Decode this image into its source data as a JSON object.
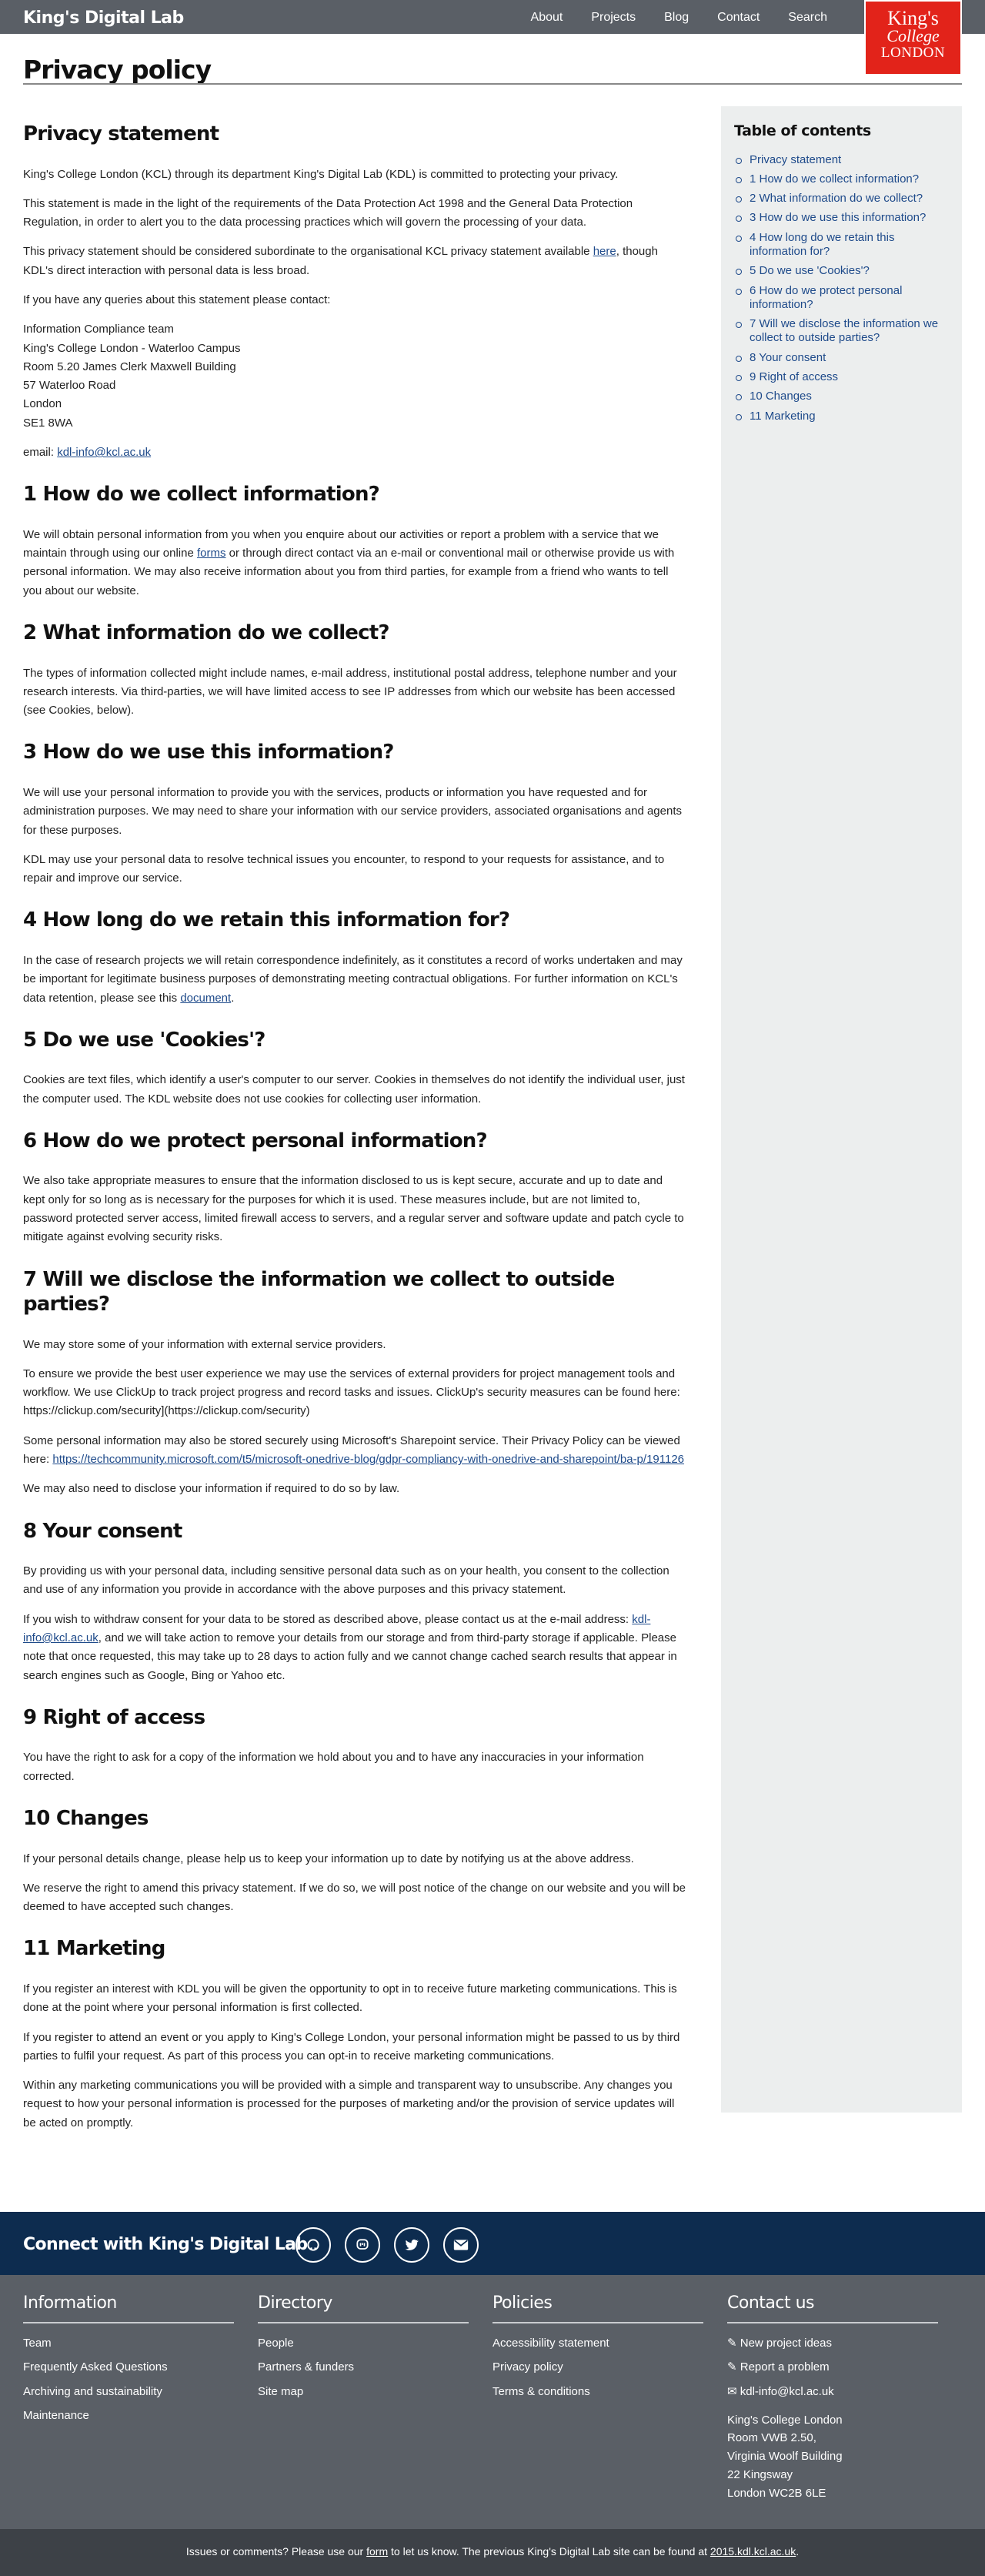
{
  "header": {
    "brand": "King's Digital Lab",
    "nav": [
      "About",
      "Projects",
      "Blog",
      "Contact",
      "Search"
    ],
    "logo": {
      "line1": "King's",
      "line2": "College",
      "line3": "LONDON"
    }
  },
  "page_title": "Privacy policy",
  "content": {
    "intro_heading": "Privacy statement",
    "intro_p1": "King's College London (KCL) through its department King's Digital Lab (KDL) is committed to protecting your privacy.",
    "intro_p2": "This statement is made in the light of the requirements of the Data Protection Act 1998 and the General Data Protection Regulation, in order to alert you to the data processing practices which will govern the processing of your data.",
    "intro_p3_before": "This privacy statement should be considered subordinate to the organisational KCL privacy statement available ",
    "intro_p3_link": "here",
    "intro_p3_after": ", though KDL's direct interaction with personal data is less broad.",
    "intro_p4": "If you have any queries about this statement please contact:",
    "address": [
      "Information Compliance team",
      "King's College London - Waterloo Campus",
      "Room 5.20 James Clerk Maxwell Building",
      "57 Waterloo Road",
      "London",
      "SE1 8WA"
    ],
    "email_label": "email: ",
    "email_link": "kdl-info@kcl.ac.uk",
    "s1_heading": "1 How do we collect information?",
    "s1_p1_before": "We will obtain personal information from you when you enquire about our activities or report a problem with a service that we maintain through using our online ",
    "s1_p1_link": "forms",
    "s1_p1_after": " or through direct contact via an e-mail or conventional mail or otherwise provide us with personal information. We may also receive information about you from third parties, for example from a friend who wants to tell you about our website.",
    "s2_heading": "2 What information do we collect?",
    "s2_p1": "The types of information collected might include names, e-mail address, institutional postal address, telephone number and your research interests. Via third-parties, we will have limited access to see IP addresses from which our website has been accessed (see Cookies, below).",
    "s3_heading": "3 How do we use this information?",
    "s3_p1": "We will use your personal information to provide you with the services, products or information you have requested and for administration purposes. We may need to share your information with our service providers, associated organisations and agents for these purposes.",
    "s3_p2": "KDL may use your personal data to resolve technical issues you encounter, to respond to your requests for assistance, and to repair and improve our service.",
    "s4_heading": "4 How long do we retain this information for?",
    "s4_p1_before": "In the case of research projects we will retain correspondence indefinitely, as it constitutes a record of works undertaken and may be important for legitimate business purposes of demonstrating meeting contractual obligations. For further information on KCL's data retention, please see this ",
    "s4_p1_link": "document",
    "s4_p1_after": ".",
    "s5_heading": "5 Do we use 'Cookies'?",
    "s5_p1": "Cookies are text files, which identify a user's computer to our server. Cookies in themselves do not identify the individual user, just the computer used. The KDL website does not use cookies for collecting user information.",
    "s6_heading": "6 How do we protect personal information?",
    "s6_p1": "We also take appropriate measures to ensure that the information disclosed to us is kept secure, accurate and up to date and kept only for so long as is necessary for the purposes for which it is used. These measures include, but are not limited to, password protected server access, limited firewall access to servers, and a regular server and software update and patch cycle to mitigate against evolving security risks.",
    "s7_heading": "7 Will we disclose the information we collect to outside parties?",
    "s7_p1": "We may store some of your information with external service providers.",
    "s7_p2": "To ensure we provide the best user experience we may use the services of external providers for project management tools and workflow. We use ClickUp to track project progress and record tasks and issues. ClickUp's security measures can be found here: https://clickup.com/security](https://clickup.com/security)",
    "s7_p3_before": "Some personal information may also be stored securely using Microsoft's Sharepoint service. Their Privacy Policy can be viewed here: ",
    "s7_p3_link": "https://techcommunity.microsoft.com/t5/microsoft-onedrive-blog/gdpr-compliancy-with-onedrive-and-sharepoint/ba-p/191126",
    "s7_p4": "We may also need to disclose your information if required to do so by law.",
    "s8_heading": "8 Your consent",
    "s8_p1": "By providing us with your personal data, including sensitive personal data such as on your health, you consent to the collection and use of any information you provide in accordance with the above purposes and this privacy statement.",
    "s8_p2_before": "If you wish to withdraw consent for your data to be stored as described above, please contact us at the e-mail address: ",
    "s8_p2_link": "kdl-info@kcl.ac.uk",
    "s8_p2_after": ", and we will take action to remove your details from our storage and from third-party storage if applicable. Please note that once requested, this may take up to 28 days to action fully and we cannot change cached search results that appear in search engines such as Google, Bing or Yahoo etc.",
    "s9_heading": "9 Right of access",
    "s9_p1": "You have the right to ask for a copy of the information we hold about you and to have any inaccuracies in your information corrected.",
    "s10_heading": "10 Changes",
    "s10_p1": "If your personal details change, please help us to keep your information up to date by notifying us at the above address.",
    "s10_p2": "We reserve the right to amend this privacy statement. If we do so, we will post notice of the change on our website and you will be deemed to have accepted such changes.",
    "s11_heading": "11 Marketing",
    "s11_p1": "If you register an interest with KDL you will be given the opportunity to opt in to receive future marketing communications. This is done at the point where your personal information is first collected.",
    "s11_p2": "If you register to attend an event or you apply to King's College London, your personal information might be passed to us by third parties to fulfil your request. As part of this process you can opt-in to receive marketing communications.",
    "s11_p3": "Within any marketing communications you will be provided with a simple and transparent way to unsubscribe. Any changes you request to how your personal information is processed for the purposes of marketing and/or the provision of service updates will be acted on promptly."
  },
  "toc": {
    "title": "Table of contents",
    "items": [
      "Privacy statement",
      "1 How do we collect information?",
      "2 What information do we collect?",
      "3 How do we use this information?",
      "4 How long do we retain this information for?",
      "5 Do we use 'Cookies'?",
      "6 How do we protect personal information?",
      "7 Will we disclose the information we collect to outside parties?",
      "8 Your consent",
      "9 Right of access",
      "10 Changes",
      "11 Marketing"
    ]
  },
  "connect": {
    "title": "Connect with King's Digital Lab",
    "icons": [
      "github-icon",
      "mastodon-icon",
      "twitter-icon",
      "email-icon"
    ]
  },
  "footer": {
    "information": {
      "title": "Information",
      "links": [
        "Team",
        "Frequently Asked Questions",
        "Archiving and sustainability",
        "Maintenance"
      ]
    },
    "directory": {
      "title": "Directory",
      "links": [
        "People",
        "Partners & funders",
        "Site map"
      ]
    },
    "policies": {
      "title": "Policies",
      "links": [
        "Accessibility statement",
        "Privacy policy",
        "Terms & conditions"
      ]
    },
    "contact": {
      "title": "Contact us",
      "links": [
        "New project ideas",
        "Report a problem",
        "kdl-info@kcl.ac.uk"
      ],
      "address": [
        "King's College London",
        "Room VWB 2.50,",
        "Virginia Woolf Building",
        "22 Kingsway",
        "London WC2B 6LE"
      ]
    },
    "bottom_before": "Issues or comments? Please use our ",
    "bottom_link1": "form",
    "bottom_middle": " to let us know. The previous King's Digital Lab site can be found at ",
    "bottom_link2": "2015.kdl.kcl.ac.uk",
    "bottom_after": "."
  },
  "colors": {
    "header": "#5a5f66",
    "connect": "#0d2c4f",
    "logo": "#e2231a",
    "link": "#1e4a8a",
    "sidebar": "#eceeee"
  }
}
